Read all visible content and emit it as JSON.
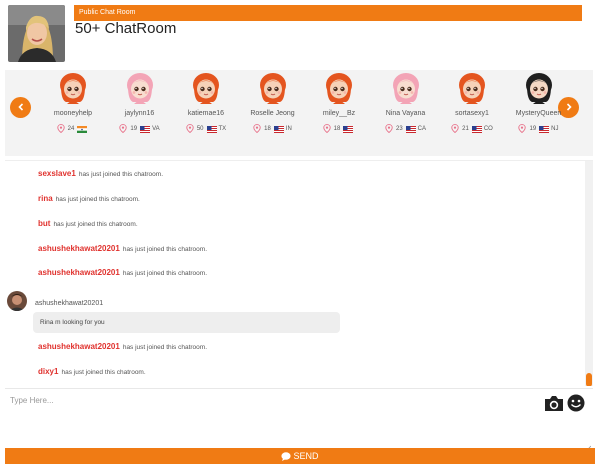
{
  "header": {
    "tag": "Public Chat Room",
    "title": "50+ ChatRoom"
  },
  "users": [
    {
      "name": "mooneyhelp",
      "age": "24",
      "flag": "india",
      "region": "",
      "avatar": "red-hair-avatar"
    },
    {
      "name": "jaylynn16",
      "age": "19",
      "flag": "usa",
      "region": "VA",
      "avatar": "pink-hair-avatar"
    },
    {
      "name": "katiemae16",
      "age": "50",
      "flag": "usa",
      "region": "TX",
      "avatar": "red-hair-avatar"
    },
    {
      "name": "Roselle Jeong",
      "age": "18",
      "flag": "usa",
      "region": "IN",
      "avatar": "red-hair-avatar"
    },
    {
      "name": "miley__Bz",
      "age": "18",
      "flag": "usa",
      "region": "",
      "avatar": "red-hair-avatar"
    },
    {
      "name": "Nina Vayana",
      "age": "23",
      "flag": "usa",
      "region": "CA",
      "avatar": "pink-hair-avatar"
    },
    {
      "name": "sortasexy1",
      "age": "21",
      "flag": "usa",
      "region": "CO",
      "avatar": "red-hair-avatar"
    },
    {
      "name": "MysteryQueen",
      "age": "19",
      "flag": "usa",
      "region": "NJ",
      "avatar": "black-hair-avatar"
    }
  ],
  "chat": {
    "system_messages": [
      {
        "user": "sexslave1",
        "text": "has just joined this chatroom."
      },
      {
        "user": "rina",
        "text": "has just joined this chatroom."
      },
      {
        "user": "but",
        "text": "has just joined this chatroom."
      },
      {
        "user": "ashushekhawat20201",
        "text": "has just joined this chatroom."
      },
      {
        "user": "ashushekhawat20201",
        "text": "has just joined this chatroom."
      },
      {
        "user": "ashushekhawat20201",
        "text": "has just joined this chatroom."
      },
      {
        "user": "dixy1",
        "text": "has just joined this chatroom."
      }
    ],
    "user_message": {
      "author": "ashushekhawat20201",
      "text": "Rina m looking for you"
    }
  },
  "composer": {
    "placeholder": "Type Here...",
    "send_label": "SEND"
  },
  "colors": {
    "accent": "#f07b14",
    "username_red": "#e0322e"
  }
}
